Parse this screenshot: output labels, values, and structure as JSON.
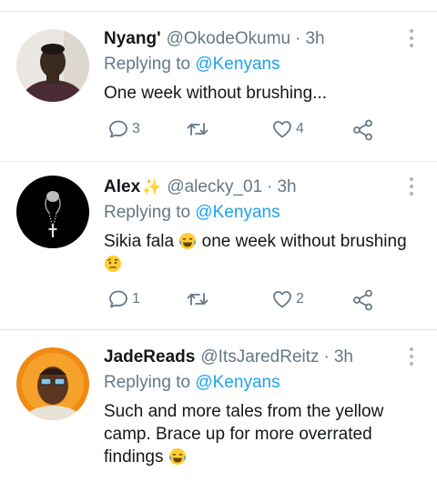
{
  "tweets": [
    {
      "name": "Nyang'",
      "name_emoji": "",
      "handle": "@OkodeOkumu",
      "time": "3h",
      "replying_prefix": "Replying to ",
      "replying_to": "@Kenyans",
      "text": "One week without brushing...",
      "replies": "3",
      "retweets": "",
      "likes": "4"
    },
    {
      "name": "Alex",
      "name_emoji": "✨",
      "handle": "@alecky_01",
      "time": "3h",
      "replying_prefix": "Replying to ",
      "replying_to": "@Kenyans",
      "text_a": "Sikia fala",
      "text_b": " one week without brushing",
      "replies": "1",
      "retweets": "",
      "likes": "2"
    },
    {
      "name": "JadeReads",
      "handle": "@ItsJaredReitz",
      "time": "3h",
      "replying_prefix": "Replying to ",
      "replying_to": "@Kenyans",
      "text_a": "Such and more tales from the yellow camp. Brace up for more overrated findings ",
      "text_b": ""
    }
  ],
  "icons": {
    "reply": "speech-bubble-icon",
    "retweet": "retweet-arrows-icon",
    "like": "heart-outline-icon",
    "share": "share-nodes-icon",
    "more": "vertical-dots-icon"
  },
  "colors": {
    "link": "#1da1f2",
    "secondary": "#657786",
    "divider": "#e1e8ed"
  }
}
